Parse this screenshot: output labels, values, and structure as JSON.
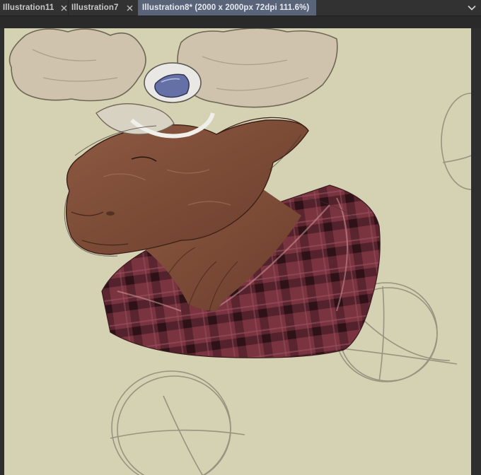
{
  "tabs": [
    {
      "label": "Illustration11",
      "active": false
    },
    {
      "label": "Illustration7",
      "active": false
    },
    {
      "label": "Illustration8* (2000 x 2000px 72dpi 111.6%)",
      "active": true
    }
  ],
  "colors": {
    "canvas_bg": "#d5d1b3",
    "active_tab": "#5a6478",
    "tabbar": "#323232",
    "fur": "#7a4a36",
    "antler": "#cfc3ad",
    "plaid": "#6e2c36"
  },
  "icons": {
    "tab_close": "close-icon",
    "tab_modified": "dot-icon",
    "tab_overflow": "chevron-down-icon"
  }
}
